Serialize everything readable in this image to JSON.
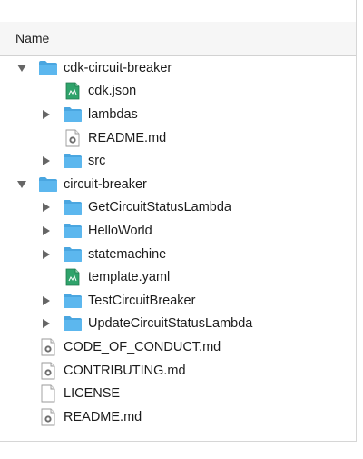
{
  "header": {
    "name_label": "Name"
  },
  "rows": [
    {
      "label": "cdk-circuit-breaker",
      "type": "folder",
      "level": 0,
      "disclosure": "open"
    },
    {
      "label": "cdk.json",
      "type": "json",
      "level": 1,
      "disclosure": "none"
    },
    {
      "label": "lambdas",
      "type": "folder",
      "level": 1,
      "disclosure": "closed"
    },
    {
      "label": "README.md",
      "type": "md",
      "level": 1,
      "disclosure": "none"
    },
    {
      "label": "src",
      "type": "folder",
      "level": 1,
      "disclosure": "closed"
    },
    {
      "label": "circuit-breaker",
      "type": "folder",
      "level": 0,
      "disclosure": "open"
    },
    {
      "label": "GetCircuitStatusLambda",
      "type": "folder",
      "level": 1,
      "disclosure": "closed"
    },
    {
      "label": "HelloWorld",
      "type": "folder",
      "level": 1,
      "disclosure": "closed"
    },
    {
      "label": "statemachine",
      "type": "folder",
      "level": 1,
      "disclosure": "closed"
    },
    {
      "label": "template.yaml",
      "type": "yaml",
      "level": 1,
      "disclosure": "none"
    },
    {
      "label": "TestCircuitBreaker",
      "type": "folder",
      "level": 1,
      "disclosure": "closed"
    },
    {
      "label": "UpdateCircuitStatusLambda",
      "type": "folder",
      "level": 1,
      "disclosure": "closed"
    },
    {
      "label": "CODE_OF_CONDUCT.md",
      "type": "md",
      "level": 0,
      "disclosure": "none"
    },
    {
      "label": "CONTRIBUTING.md",
      "type": "md",
      "level": 0,
      "disclosure": "none"
    },
    {
      "label": "LICENSE",
      "type": "text",
      "level": 0,
      "disclosure": "none"
    },
    {
      "label": "README.md",
      "type": "md",
      "level": 0,
      "disclosure": "none"
    }
  ],
  "icons": {
    "folder": "folder-icon",
    "json": "json-file-icon",
    "yaml": "yaml-file-icon",
    "md": "markdown-file-icon",
    "text": "text-file-icon",
    "open": "disclosure-open-icon",
    "closed": "disclosure-closed-icon"
  },
  "colors": {
    "folder": "#5cb7ee",
    "folder_tab": "#4aa6e0",
    "green_file": "#2fa36b",
    "header_bg": "#f6f6f6"
  }
}
